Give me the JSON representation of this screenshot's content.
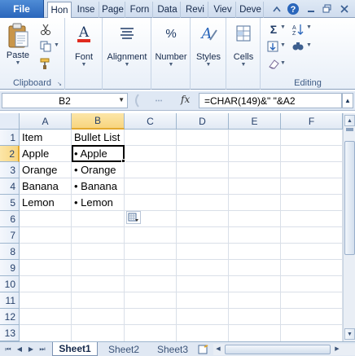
{
  "tabs": {
    "file": "File",
    "items": [
      "Hon",
      "Inse",
      "Page",
      "Forn",
      "Data",
      "Revi",
      "Viev",
      "Deve"
    ],
    "active_index": 0
  },
  "ribbon": {
    "clipboard": {
      "paste": "Paste",
      "label": "Clipboard"
    },
    "font": {
      "label": "Font"
    },
    "alignment": {
      "label": "Alignment"
    },
    "number": {
      "label": "Number",
      "icon_text": "%"
    },
    "styles": {
      "label": "Styles"
    },
    "cells": {
      "label": "Cells"
    },
    "editing": {
      "label": "Editing"
    }
  },
  "formula_bar": {
    "name_box": "B2",
    "fx": "fx",
    "formula": "=CHAR(149)&\" \"&A2"
  },
  "grid": {
    "columns": [
      "A",
      "B",
      "C",
      "D",
      "E",
      "F"
    ],
    "selected_column": "B",
    "rows": [
      "1",
      "2",
      "3",
      "4",
      "5",
      "6",
      "7",
      "8",
      "9",
      "10",
      "11",
      "12",
      "13"
    ],
    "selected_row": "2",
    "cells": {
      "A1": "Item",
      "B1": "Bullet List",
      "A2": "Apple",
      "B2": "• Apple",
      "A3": "Orange",
      "B3": "• Orange",
      "A4": "Banana",
      "B4": "• Banana",
      "A5": "Lemon",
      "B5": "• Lemon"
    },
    "active_cell": "B2"
  },
  "sheets": {
    "tabs": [
      "Sheet1",
      "Sheet2",
      "Sheet3"
    ],
    "active": "Sheet1"
  },
  "colors": {
    "accent": "#2a66bb",
    "selected_header": "#f8d57f",
    "ribbon_bg": "#e8eff8"
  }
}
